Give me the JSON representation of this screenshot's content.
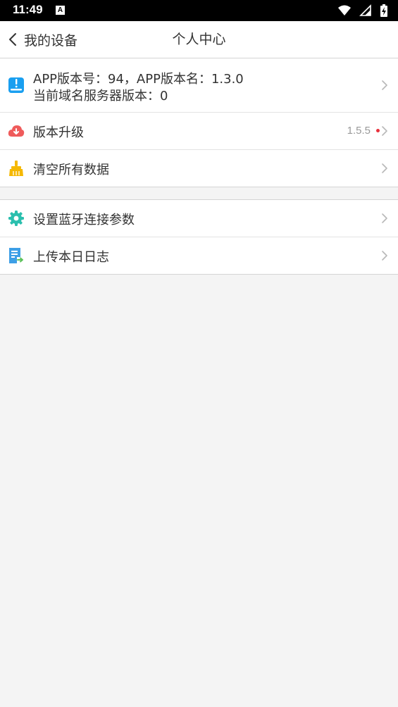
{
  "status_bar": {
    "time": "11:49",
    "app_indicator": "A"
  },
  "header": {
    "back_label": "我的设备",
    "title": "个人中心"
  },
  "group1": {
    "info": {
      "line1": "APP版本号：94，APP版本名：1.3.0",
      "line2": "当前域名服务器版本：0",
      "icon": "info-card-icon"
    },
    "upgrade": {
      "label": "版本升级",
      "value": "1.5.5",
      "icon": "cloud-download-icon",
      "badge_color": "#e8303b"
    },
    "clear": {
      "label": "清空所有数据",
      "icon": "broom-icon"
    }
  },
  "group2": {
    "bluetooth": {
      "label": "设置蓝牙连接参数",
      "icon": "gear-icon"
    },
    "upload_log": {
      "label": "上传本日日志",
      "icon": "upload-log-icon"
    }
  },
  "colors": {
    "background": "#f4f4f4",
    "info_icon": "#1a9ff0",
    "upgrade_icon": "#ef5b5b",
    "clear_icon": "#f5b800",
    "gear_icon": "#2bbfae",
    "log_icon": "#3d9fe6"
  }
}
